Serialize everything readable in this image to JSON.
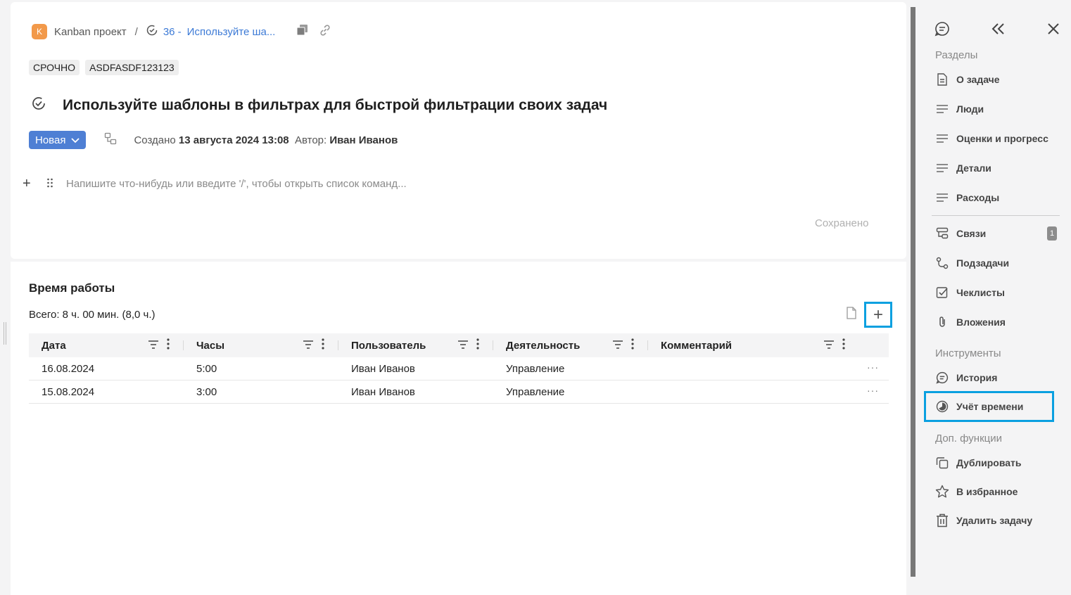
{
  "breadcrumb": {
    "project_badge": "K",
    "project": "Kanban проект",
    "separator": "/",
    "task_number": "36 -",
    "task_short": "Используйте ша..."
  },
  "tags": [
    "СРОЧНО",
    "ASDFASDF123123"
  ],
  "task": {
    "title": "Используйте шаблоны в фильтрах для быстрой фильтрации своих задач",
    "status": "Новая",
    "created_label": "Создано",
    "created_date": "13 августа 2024 13:08",
    "author_label": "Автор:",
    "author": "Иван Иванов"
  },
  "editor": {
    "placeholder": "Напишите что-нибудь или введите '/', чтобы открыть список команд...",
    "saved": "Сохранено"
  },
  "worklog": {
    "title": "Время работы",
    "total": "Всего: 8 ч. 00 мин. (8,0 ч.)",
    "add_symbol": "+",
    "columns": [
      "Дата",
      "Часы",
      "Пользователь",
      "Деятельность",
      "Комментарий"
    ],
    "rows": [
      [
        "16.08.2024",
        "5:00",
        "Иван Иванов",
        "Управление",
        ""
      ],
      [
        "15.08.2024",
        "3:00",
        "Иван Иванов",
        "Управление",
        ""
      ]
    ],
    "row_more": "···"
  },
  "right_panel": {
    "sections_head": "Разделы",
    "sections": [
      "О задаче",
      "Люди",
      "Оценки и прогресс",
      "Детали",
      "Расходы"
    ],
    "links": [
      "Связи",
      "Подзадачи",
      "Чеклисты",
      "Вложения"
    ],
    "links_badge": "1",
    "tools_head": "Инструменты",
    "tools": [
      "История",
      "Учёт времени"
    ],
    "extra_head": "Доп. функции",
    "extra": [
      "Дублировать",
      "В избранное",
      "Удалить задачу"
    ]
  },
  "colors": {
    "accent": "#4e7fd4",
    "link": "#3c7ad6",
    "highlight": "#0aa0e0",
    "project_badge": "#f2994a"
  }
}
